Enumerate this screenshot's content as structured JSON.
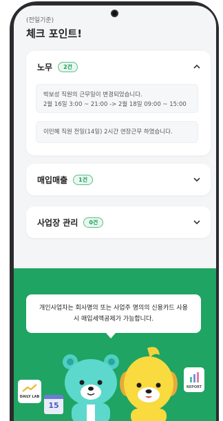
{
  "header": {
    "subtitle": "(전일기준)",
    "title": "체크 포인트!"
  },
  "cards": [
    {
      "title": "노무",
      "badge": "2건",
      "expanded": true,
      "notes": [
        {
          "line1": "박보성 직원의 근무일이 변경되었습니다.",
          "line2": "2월 16일 3:00 ~ 21:00 -> 2월 18일 09:00 ~ 15:00"
        },
        {
          "line1": "이민혜 직원 전일(14일) 2시간 연장근무 하였습니다.",
          "line2": ""
        }
      ]
    },
    {
      "title": "매입매출",
      "badge": "1건",
      "expanded": false
    },
    {
      "title": "사업장 관리",
      "badge": "0건",
      "expanded": false
    }
  ],
  "banner": {
    "text": "개인사업자는 회사명의 또는 사업주 명의의 신용카드 사용 시 매입세액공제가 가능합니다.",
    "daily_lab": "DAILY LAB",
    "calendar_day": "15",
    "report": "REPORT",
    "background": "#1fa463"
  },
  "colors": {
    "accent": "#1fa463",
    "badge_text": "#1a9d5c"
  },
  "icons": {
    "collapse": "chevron-up-icon",
    "expand": "chevron-down-icon"
  }
}
